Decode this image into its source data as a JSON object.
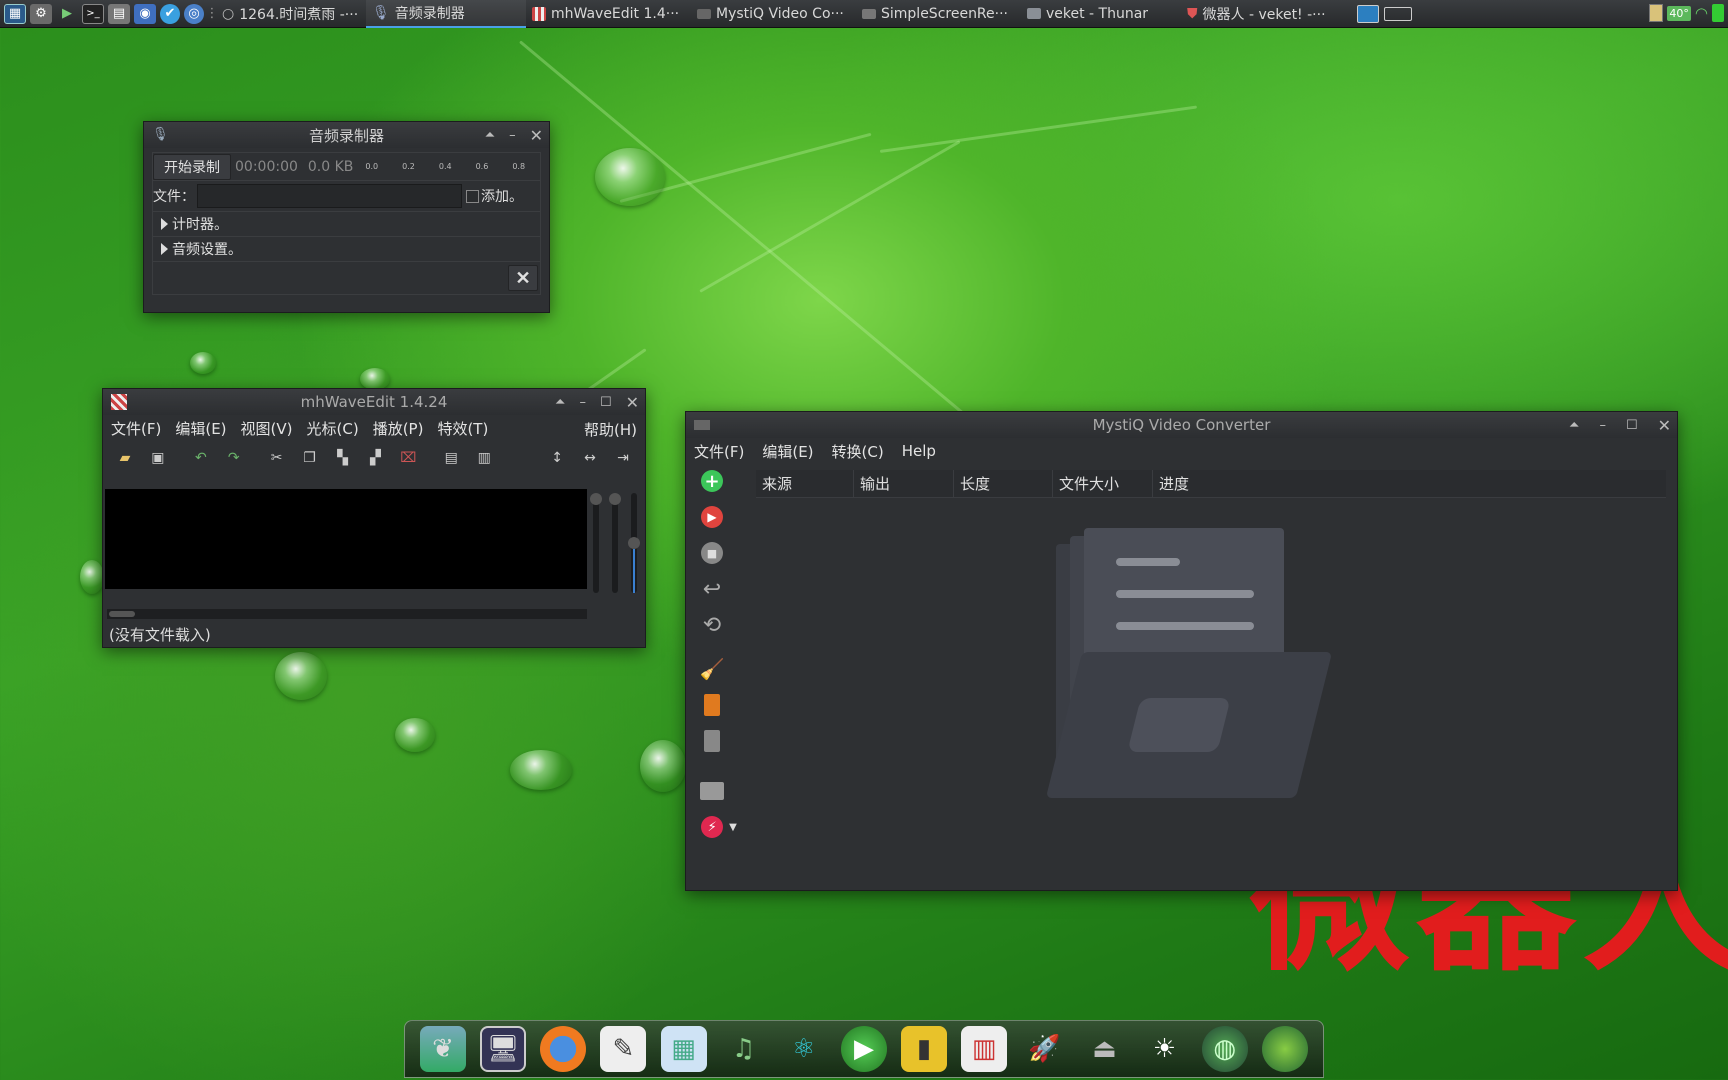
{
  "taskbar": {
    "tasks": [
      {
        "label": "1264.时间煮雨 -···"
      },
      {
        "label": "音频录制器"
      },
      {
        "label": "mhWaveEdit 1.4···"
      },
      {
        "label": "MystiQ Video Co···"
      },
      {
        "label": "SimpleScreenRe···"
      },
      {
        "label": "veket - Thunar"
      },
      {
        "label": "微器人 - veket! -···"
      }
    ],
    "temperature": "40°"
  },
  "recorder": {
    "title": "音频录制器",
    "record_label": "开始录制",
    "time": "00:00:00",
    "size": "0.0 KB",
    "meter_ticks": [
      "0.0",
      "0.2",
      "0.4",
      "0.6",
      "0.8"
    ],
    "file_label": "文件：",
    "file_value": "",
    "append_label": "添加。",
    "timer_label": "计时器。",
    "audio_settings_label": "音频设置。"
  },
  "wave": {
    "title": "mhWaveEdit 1.4.24",
    "menu": [
      "文件(F)",
      "编辑(E)",
      "视图(V)",
      "光标(C)",
      "播放(P)",
      "特效(T)"
    ],
    "help": "帮助(H)",
    "status": "(没有文件载入)"
  },
  "mystiq": {
    "title": "MystiQ Video Converter",
    "menu": [
      "文件(F)",
      "编辑(E)",
      "转换(C)",
      "Help"
    ],
    "columns": [
      "来源",
      "输出",
      "长度",
      "文件大小",
      "进度"
    ]
  },
  "watermark": "微器人",
  "colors": {
    "accent_blue": "#4aa0e8",
    "watermark_red": "#e11d1d",
    "window_bg": "#2e3033"
  }
}
